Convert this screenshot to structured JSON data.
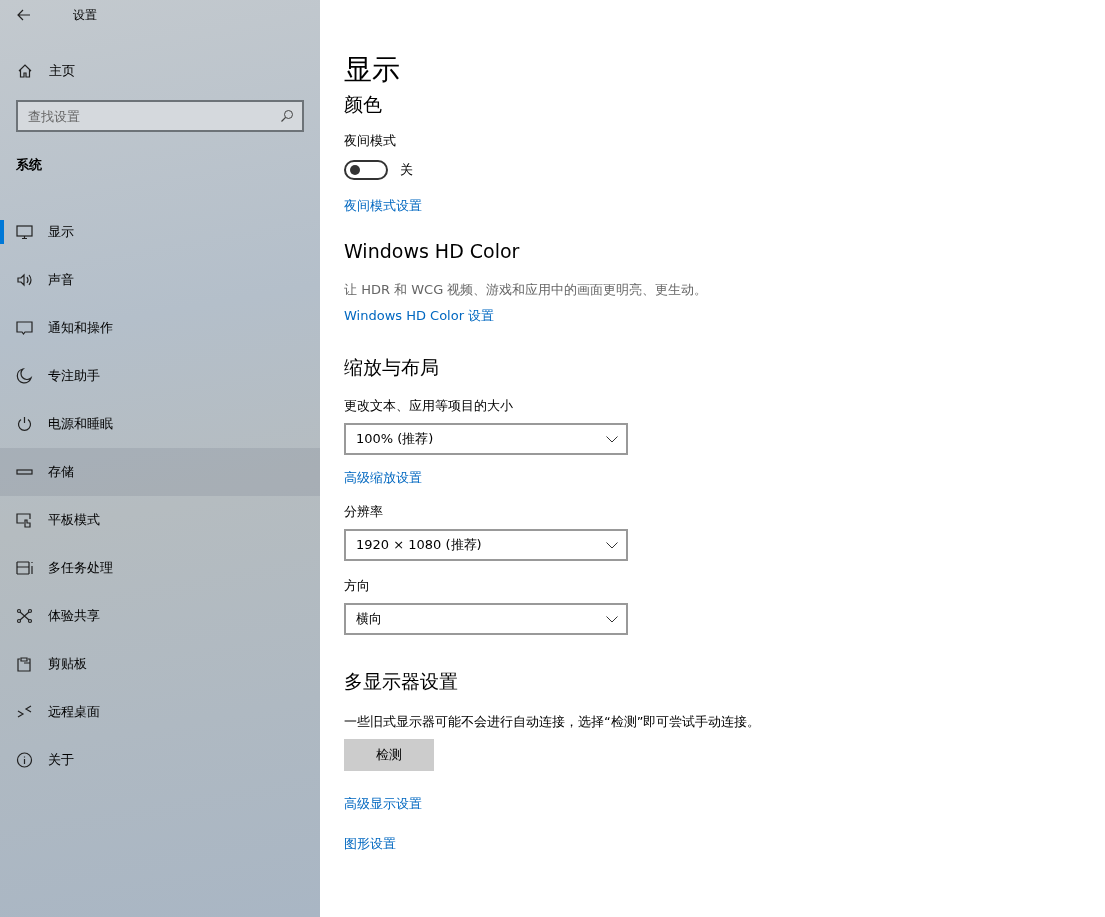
{
  "window": {
    "title": "设置"
  },
  "sidebar": {
    "home": "主页",
    "search": {
      "placeholder": "查找设置"
    },
    "section": "系统",
    "items": [
      {
        "label": "显示",
        "selected": true,
        "hovered": false
      },
      {
        "label": "声音",
        "selected": false,
        "hovered": false
      },
      {
        "label": "通知和操作",
        "selected": false,
        "hovered": false
      },
      {
        "label": "专注助手",
        "selected": false,
        "hovered": false
      },
      {
        "label": "电源和睡眠",
        "selected": false,
        "hovered": false
      },
      {
        "label": "存储",
        "selected": false,
        "hovered": true
      },
      {
        "label": "平板模式",
        "selected": false,
        "hovered": false
      },
      {
        "label": "多任务处理",
        "selected": false,
        "hovered": false
      },
      {
        "label": "体验共享",
        "selected": false,
        "hovered": false
      },
      {
        "label": "剪贴板",
        "selected": false,
        "hovered": false
      },
      {
        "label": "远程桌面",
        "selected": false,
        "hovered": false
      },
      {
        "label": "关于",
        "selected": false,
        "hovered": false
      }
    ]
  },
  "page": {
    "title": "显示",
    "color": {
      "heading": "颜色",
      "night_light": {
        "label": "夜间模式",
        "on": false,
        "state_text": "关"
      },
      "link": "夜间模式设置"
    },
    "hd_color": {
      "heading": "Windows HD Color",
      "description": "让 HDR 和 WCG 视频、游戏和应用中的画面更明亮、更生动。",
      "link": "Windows HD Color 设置"
    },
    "scale_layout": {
      "heading": "缩放与布局",
      "fields": [
        {
          "label": "更改文本、应用等项目的大小",
          "value": "100% (推荐)",
          "link": "高级缩放设置"
        },
        {
          "label": "分辨率",
          "value": "1920 × 1080 (推荐)"
        },
        {
          "label": "方向",
          "value": "横向"
        }
      ]
    },
    "multi_display": {
      "heading": "多显示器设置",
      "description": "一些旧式显示器可能不会进行自动连接，选择“检测”即可尝试手动连接。",
      "button": "检测"
    },
    "links": [
      "高级显示设置",
      "图形设置"
    ]
  }
}
